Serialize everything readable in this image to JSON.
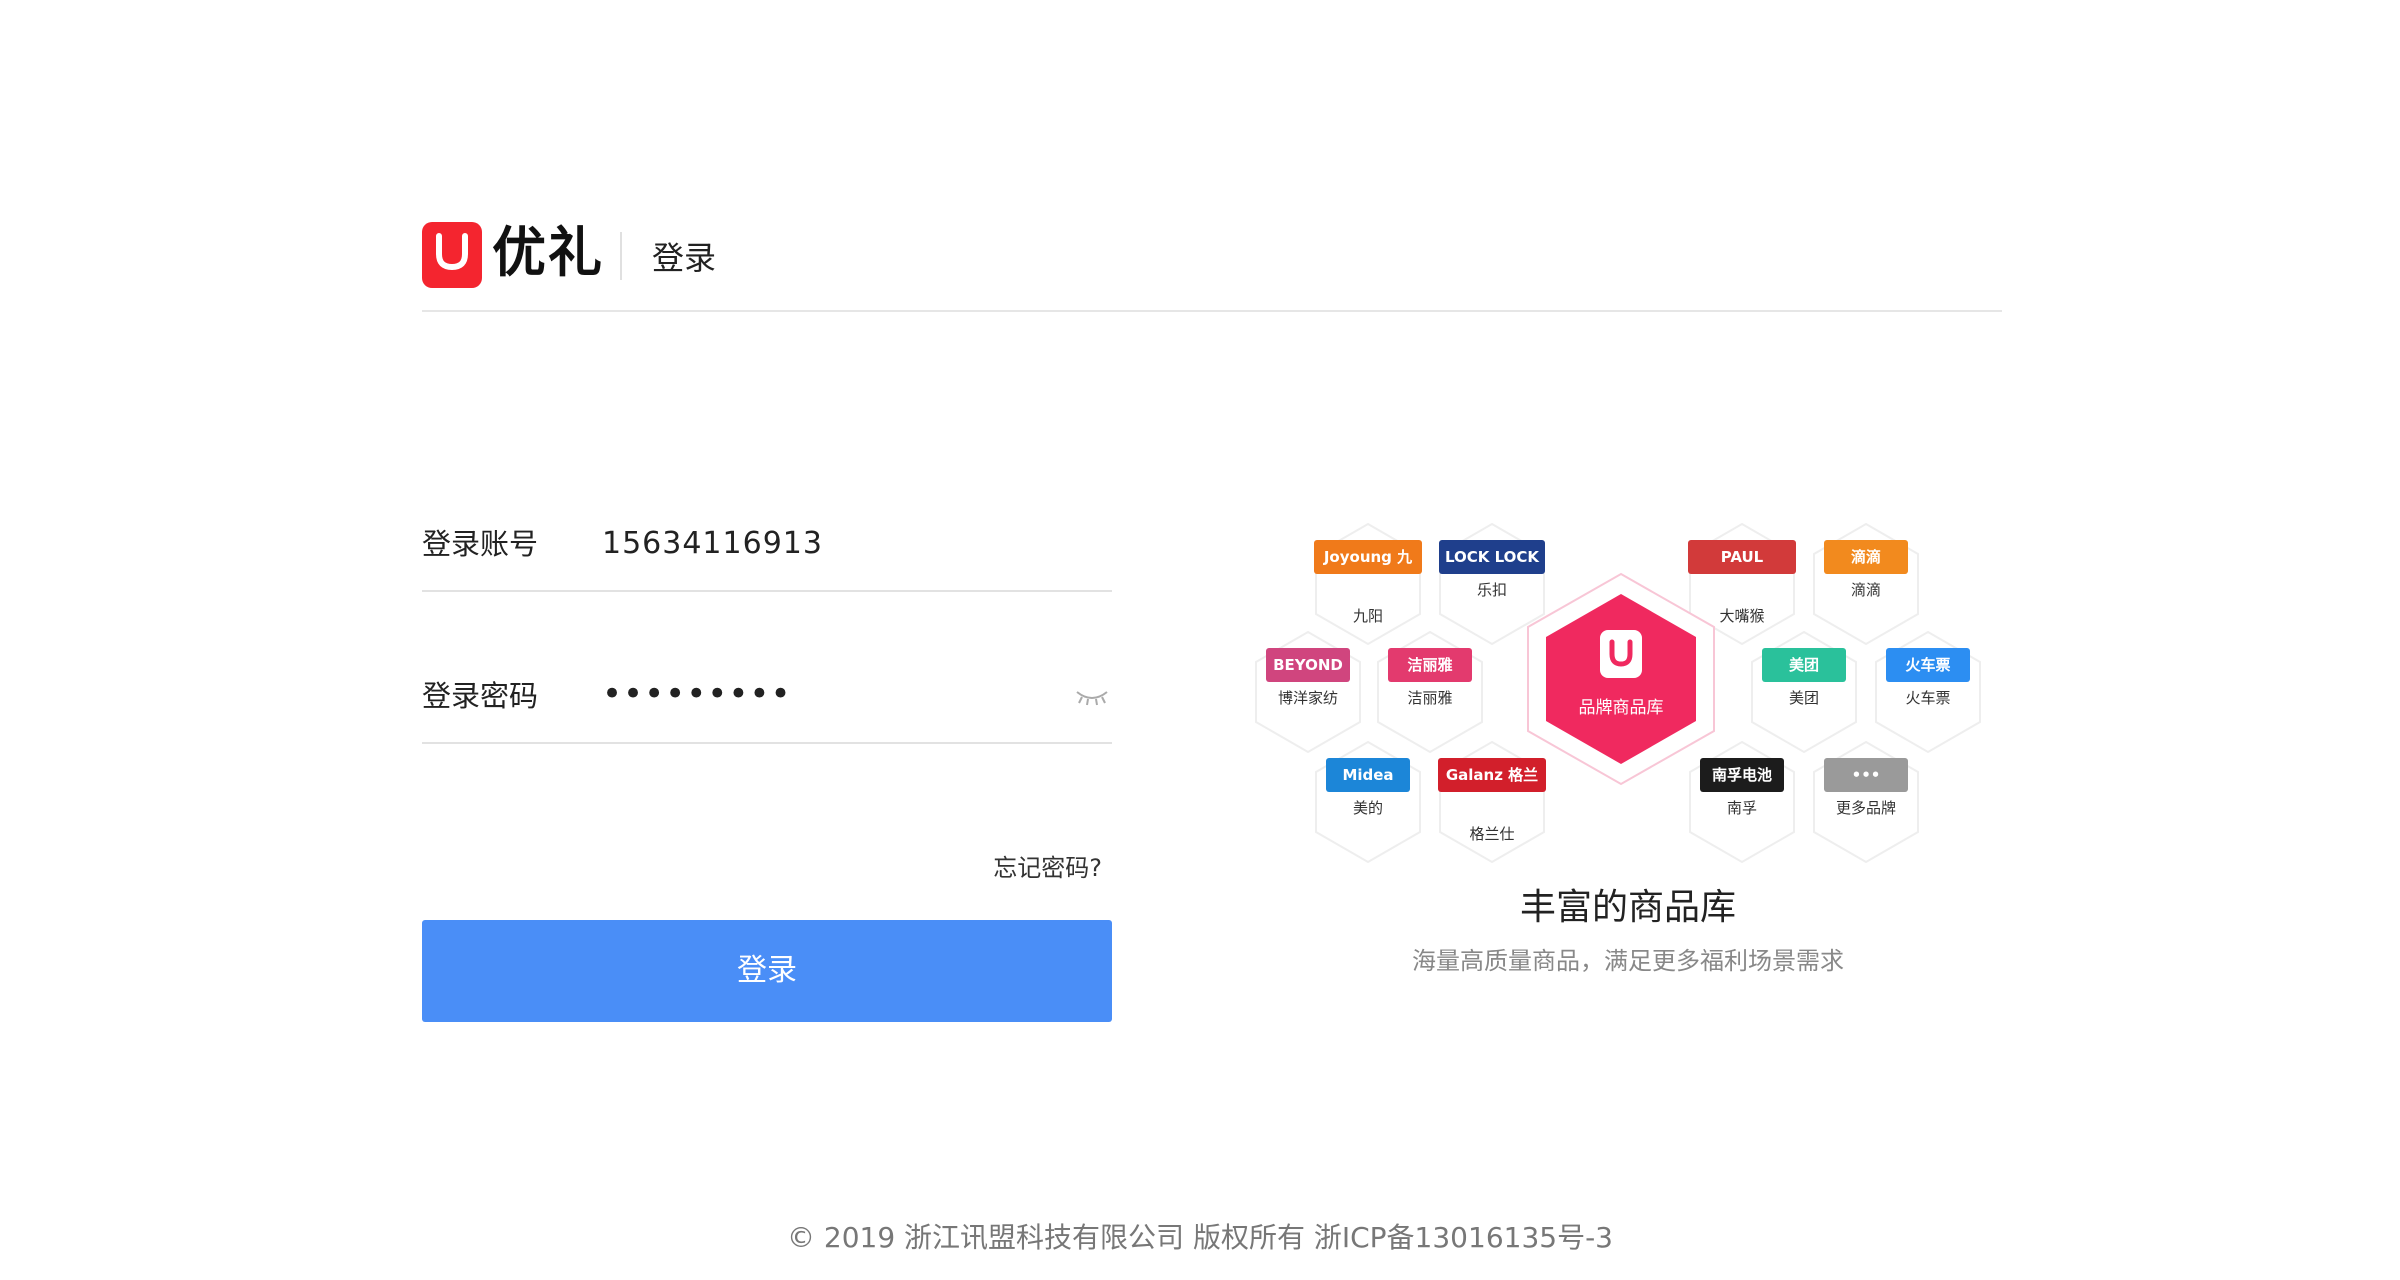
{
  "brand": {
    "name": "优礼",
    "page_title": "登录"
  },
  "form": {
    "account_label": "登录账号",
    "account_value": "15634116913",
    "password_label": "登录密码",
    "password_value": "•••••••••",
    "forgot_link": "忘记密码?",
    "submit_label": "登录"
  },
  "promo": {
    "center_label": "品牌商品库",
    "title": "丰富的商品库",
    "subtitle": "海量高质量商品，满足更多福利场景需求",
    "brands": [
      {
        "badge": "Joyoung 九阳",
        "label": "九阳",
        "color": "#f07a1a"
      },
      {
        "badge": "LOCK LOCK",
        "label": "乐扣",
        "color": "#1f3f8c"
      },
      {
        "badge": "PAUL FRANK",
        "label": "大嘴猴",
        "color": "#d23a3a"
      },
      {
        "badge": "滴滴",
        "label": "滴滴",
        "color": "#f28a1e"
      },
      {
        "badge": "BEYOND",
        "label": "博洋家纺",
        "color": "#d0457e"
      },
      {
        "badge": "洁丽雅",
        "label": "洁丽雅",
        "color": "#e33a6e"
      },
      {
        "badge": "美团",
        "label": "美团",
        "color": "#2ac19b"
      },
      {
        "badge": "火车票",
        "label": "火车票",
        "color": "#2c8ef2"
      },
      {
        "badge": "Midea",
        "label": "美的",
        "color": "#1c86d8"
      },
      {
        "badge": "Galanz 格兰仕",
        "label": "格兰仕",
        "color": "#d21f2b"
      },
      {
        "badge": "南孚电池",
        "label": "南孚",
        "color": "#1c1c1c"
      },
      {
        "badge": "•••",
        "label": "更多品牌",
        "color": "#9a9a9a"
      }
    ]
  },
  "footer": {
    "text": "© 2019 浙江讯盟科技有限公司 版权所有 浙ICP备13016135号-3"
  }
}
